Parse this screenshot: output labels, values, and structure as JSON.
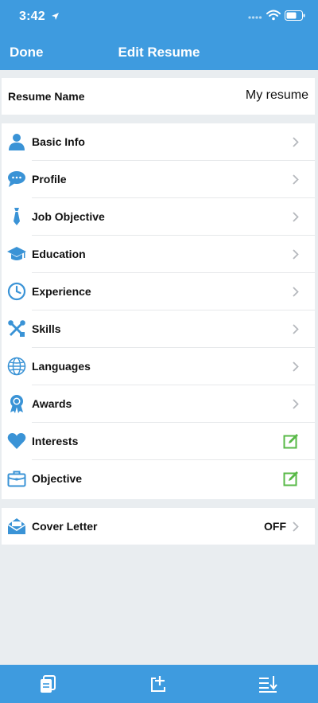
{
  "status_bar": {
    "time": "3:42"
  },
  "nav": {
    "done_label": "Done",
    "title": "Edit Resume"
  },
  "resume_name": {
    "label": "Resume Name",
    "value": "My resume"
  },
  "sections": [
    {
      "label": "Basic Info",
      "icon": "person-icon",
      "accessory": "chevron"
    },
    {
      "label": "Profile",
      "icon": "chat-bubble-icon",
      "accessory": "chevron"
    },
    {
      "label": "Job Objective",
      "icon": "tie-icon",
      "accessory": "chevron"
    },
    {
      "label": "Education",
      "icon": "graduation-cap-icon",
      "accessory": "chevron"
    },
    {
      "label": "Experience",
      "icon": "clock-icon",
      "accessory": "chevron"
    },
    {
      "label": "Skills",
      "icon": "tools-icon",
      "accessory": "chevron"
    },
    {
      "label": "Languages",
      "icon": "globe-icon",
      "accessory": "chevron"
    },
    {
      "label": "Awards",
      "icon": "award-ribbon-icon",
      "accessory": "chevron"
    },
    {
      "label": "Interests",
      "icon": "heart-icon",
      "accessory": "edit"
    },
    {
      "label": "Objective",
      "icon": "briefcase-icon",
      "accessory": "edit"
    }
  ],
  "cover_letter": {
    "label": "Cover Letter",
    "icon": "envelope-icon",
    "status": "OFF"
  },
  "tabbar": {
    "items": [
      "documents-icon",
      "add-section-icon",
      "reorder-icon"
    ]
  },
  "colors": {
    "accent": "#3e9bdf",
    "icon_blue": "#3a93d6",
    "edit_green": "#58b947",
    "background": "#e9edf0"
  }
}
